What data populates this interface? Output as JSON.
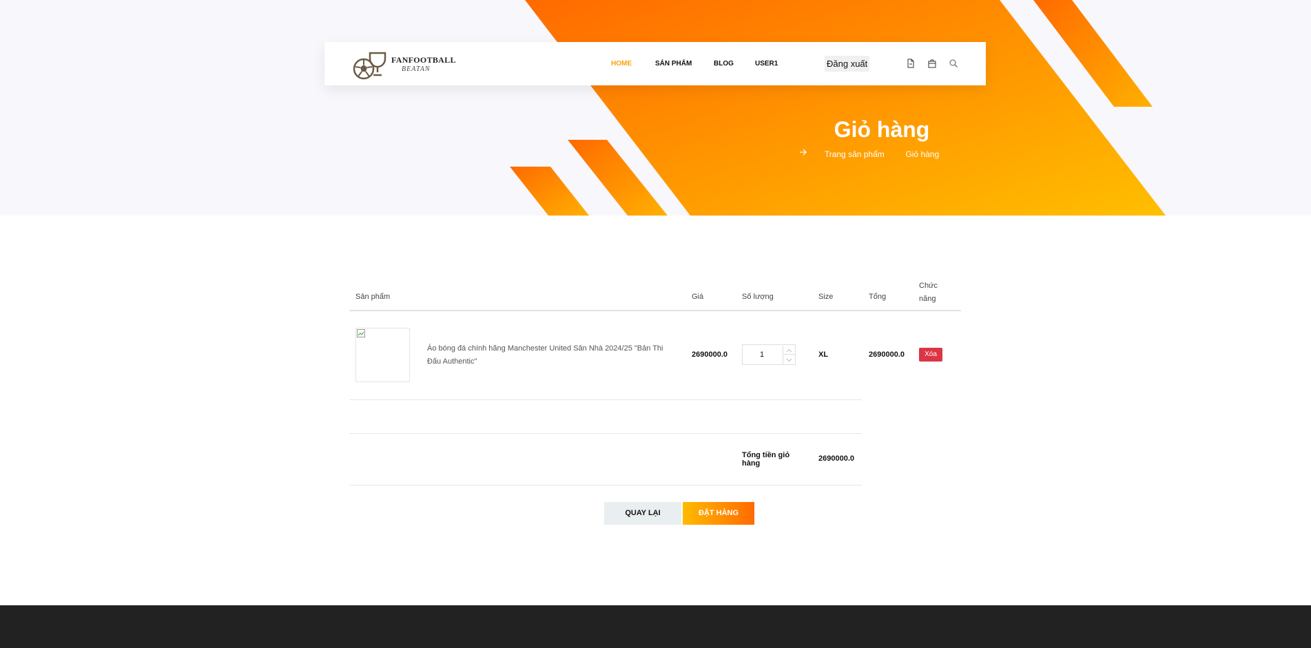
{
  "header": {
    "logo_text": "FANFOOTBALL",
    "logo_sub": "BEATAN",
    "nav": {
      "home": "HOME",
      "products": "SẢN PHẨM",
      "blog": "BLOG",
      "user": "USER1"
    },
    "logout_label": "Đăng xuất",
    "icons": [
      "document-icon",
      "shopping-bag-icon",
      "search-icon"
    ]
  },
  "hero": {
    "title": "Giỏ hàng",
    "breadcrumb": {
      "parent": "Trang sản phẩm",
      "current": "Giỏ hàng"
    }
  },
  "cart": {
    "headers": {
      "product": "Sản phẩm",
      "price": "Giá",
      "quantity": "Số lượng",
      "size": "Size",
      "total": "Tổng",
      "action": "Chức năng"
    },
    "items": [
      {
        "name": "Áo bóng đá chính hãng Manchester United Sân Nhà 2024/25 \"Bản Thi Đấu Authentic\"",
        "price": "2690000.0",
        "quantity": "1",
        "size": "XL",
        "total": "2690000.0",
        "delete_label": "Xóa"
      }
    ],
    "summary_label": "Tổng tiền giỏ hàng",
    "summary_value": "2690000.0"
  },
  "actions": {
    "back_label": "QUAY LẠI",
    "order_label": "ĐẶT HÀNG"
  },
  "colors": {
    "accent": "#f6a20f",
    "hero_orange": "#ff7300",
    "hero_yellow": "#ffbb00",
    "delete": "#dc3545",
    "footer": "#222222"
  }
}
